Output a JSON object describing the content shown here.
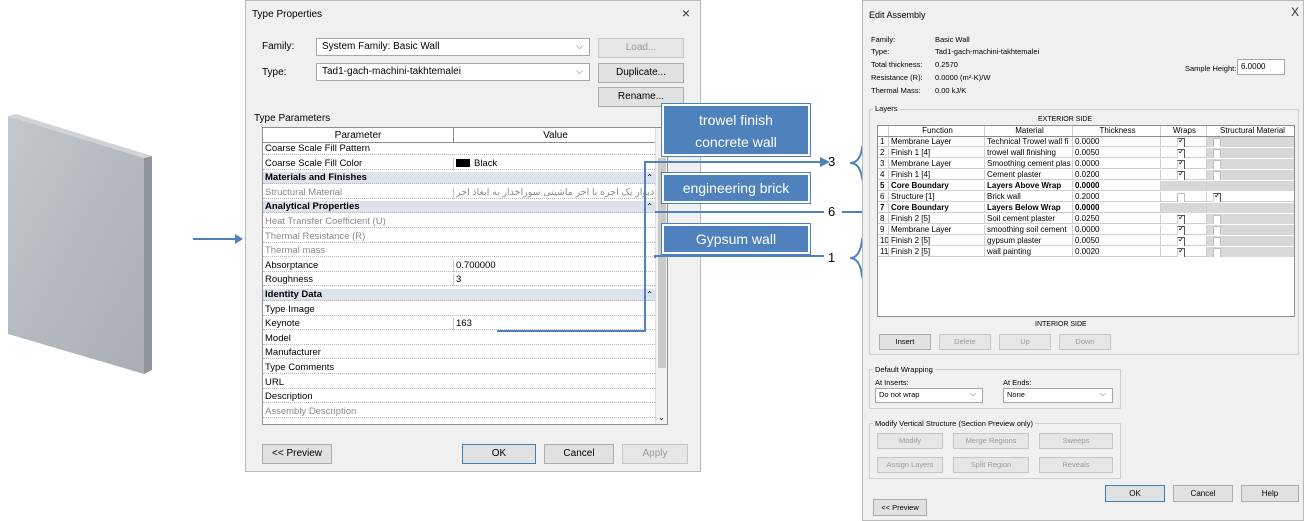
{
  "type_properties": {
    "title": "Type Properties",
    "close": "×",
    "family_label": "Family:",
    "family_value": "System Family: Basic Wall",
    "type_label": "Type:",
    "type_value": "Tad1-gach-machini-takhtemalei",
    "load_button": "Load...",
    "duplicate_button": "Duplicate...",
    "rename_button": "Rename...",
    "type_parameters_label": "Type Parameters",
    "col_parameter": "Parameter",
    "col_value": "Value",
    "rows": [
      {
        "param": "Coarse Scale Fill Pattern",
        "value": "",
        "kind": "normal"
      },
      {
        "param": "Coarse Scale Fill Color",
        "value": "Black",
        "kind": "color"
      },
      {
        "param": "Materials and Finishes",
        "value": "",
        "kind": "group"
      },
      {
        "param": "Structural Material",
        "value": "دیوار یک آجره با آجر ماشینی سوراخدار به ابعاد آجر",
        "kind": "gray"
      },
      {
        "param": "Analytical Properties",
        "value": "",
        "kind": "group"
      },
      {
        "param": "Heat Transfer Coefficient (U)",
        "value": "",
        "kind": "gray"
      },
      {
        "param": "Thermal Resistance (R)",
        "value": "",
        "kind": "gray"
      },
      {
        "param": "Thermal mass",
        "value": "",
        "kind": "gray"
      },
      {
        "param": "Absorptance",
        "value": "0.700000",
        "kind": "normal"
      },
      {
        "param": "Roughness",
        "value": "3",
        "kind": "normal"
      },
      {
        "param": "Identity Data",
        "value": "",
        "kind": "group"
      },
      {
        "param": "Type Image",
        "value": "",
        "kind": "normal"
      },
      {
        "param": "Keynote",
        "value": "163",
        "kind": "normal"
      },
      {
        "param": "Model",
        "value": "",
        "kind": "normal"
      },
      {
        "param": "Manufacturer",
        "value": "",
        "kind": "normal"
      },
      {
        "param": "Type Comments",
        "value": "",
        "kind": "normal"
      },
      {
        "param": "URL",
        "value": "",
        "kind": "normal"
      },
      {
        "param": "Description",
        "value": "",
        "kind": "normal"
      },
      {
        "param": "Assembly Description",
        "value": "",
        "kind": "gray"
      }
    ],
    "preview_button": "<< Preview",
    "ok_button": "OK",
    "cancel_button": "Cancel",
    "apply_button": "Apply"
  },
  "callouts": {
    "trowel_line1": "trowel finish",
    "trowel_line2": "concrete wall",
    "brick": "engineering brick",
    "gypsum": "Gypsum wall",
    "num_3": "3",
    "num_6": "6",
    "num_1": "1"
  },
  "edit_assembly": {
    "title": "Edit Assembly",
    "close": "X",
    "family_label": "Family:",
    "family_value": "Basic Wall",
    "type_label": "Type:",
    "type_value": "Tad1-gach-machini-takhtemalei",
    "thickness_label": "Total thickness:",
    "thickness_value": "0.2570",
    "resistance_label": "Resistance (R):",
    "resistance_value": "0.0000 (m²·K)/W",
    "mass_label": "Thermal Mass:",
    "mass_value": "0.00 kJ/K",
    "sample_height_label": "Sample Height:",
    "sample_height_value": "6.0000",
    "layers_label": "Layers",
    "exterior_side": "EXTERIOR SIDE",
    "interior_side": "INTERIOR SIDE",
    "columns": [
      "Function",
      "Material",
      "Thickness",
      "Wraps",
      "Structural Material"
    ],
    "layers": [
      {
        "n": "1",
        "function": "Membrane Layer",
        "material": "Technical Trowel wall fi",
        "thickness": "0.0000",
        "wraps": true,
        "structural": false,
        "core": false
      },
      {
        "n": "2",
        "function": "Finish 1 [4]",
        "material": "trowel wall finishing",
        "thickness": "0.0050",
        "wraps": true,
        "structural": false,
        "core": false
      },
      {
        "n": "3",
        "function": "Membrane Layer",
        "material": "Smoothing cement plas",
        "thickness": "0.0000",
        "wraps": true,
        "structural": false,
        "core": false
      },
      {
        "n": "4",
        "function": "Finish 1 [4]",
        "material": "Cement plaster",
        "thickness": "0.0200",
        "wraps": true,
        "structural": false,
        "core": false
      },
      {
        "n": "5",
        "function": "Core Boundary",
        "material": "Layers Above Wrap",
        "thickness": "0.0000",
        "wraps": null,
        "structural": null,
        "core": true
      },
      {
        "n": "6",
        "function": "Structure [1]",
        "material": "Brick wall",
        "thickness": "0.2000",
        "wraps": false,
        "structural": true,
        "core": false
      },
      {
        "n": "7",
        "function": "Core Boundary",
        "material": "Layers Below Wrap",
        "thickness": "0.0000",
        "wraps": null,
        "structural": null,
        "core": true
      },
      {
        "n": "8",
        "function": "Finish 2 [5]",
        "material": "Soil cement plaster",
        "thickness": "0.0250",
        "wraps": true,
        "structural": false,
        "core": false
      },
      {
        "n": "9",
        "function": "Membrane Layer",
        "material": "smoothing soil cement",
        "thickness": "0.0000",
        "wraps": true,
        "structural": false,
        "core": false
      },
      {
        "n": "10",
        "function": "Finish 2 [5]",
        "material": "gypsum plaster",
        "thickness": "0.0050",
        "wraps": true,
        "structural": false,
        "core": false
      },
      {
        "n": "11",
        "function": "Finish 2 [5]",
        "material": "wall painting",
        "thickness": "0.0020",
        "wraps": true,
        "structural": false,
        "core": false
      }
    ],
    "insert_button": "Insert",
    "delete_button": "Delete",
    "up_button": "Up",
    "down_button": "Down",
    "default_wrapping_label": "Default Wrapping",
    "at_inserts_label": "At Inserts:",
    "at_inserts_value": "Do not wrap",
    "at_ends_label": "At Ends:",
    "at_ends_value": "None",
    "modify_vertical_label": "Modify Vertical Structure (Section Preview only)",
    "modify_button": "Modify",
    "merge_regions_button": "Merge Regions",
    "sweeps_button": "Sweeps",
    "assign_layers_button": "Assign Layers",
    "split_region_button": "Split Region",
    "reveals_button": "Reveals",
    "ok_button": "OK",
    "cancel_button": "Cancel",
    "help_button": "Help",
    "preview_button": "<< Preview"
  },
  "colors": {
    "callout_fill": "#4f81bd",
    "group_header": "#dce3ec",
    "wall_surface": "#b7bdc2"
  }
}
